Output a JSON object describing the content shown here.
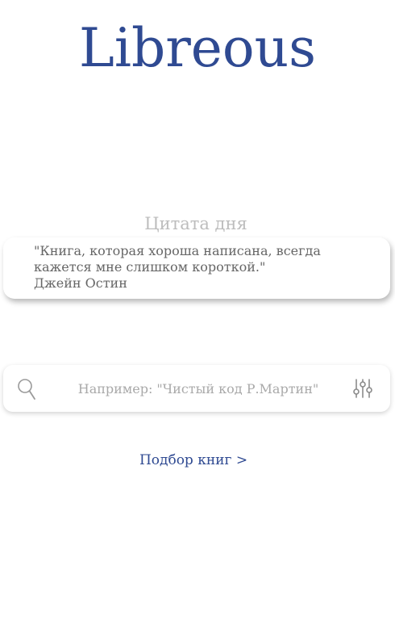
{
  "app": {
    "logo_text": "Libreous"
  },
  "quote": {
    "title": "Цитата дня",
    "line1": "\"Книга, которая хороша написана, всегда",
    "line2": "кажется мне слишком короткой.\"",
    "author": "Джейн Остин"
  },
  "search": {
    "placeholder": "Например: \"Чистый код Р.Мартин\"",
    "value": "",
    "icon": "search-icon",
    "filter_icon": "sliders-icon"
  },
  "links": {
    "pick_books": "Подбор книг >"
  },
  "colors": {
    "brand": "#2f4a92",
    "muted": "#bdbdbd",
    "quote_text": "#666666",
    "placeholder": "#a9a9a9"
  }
}
